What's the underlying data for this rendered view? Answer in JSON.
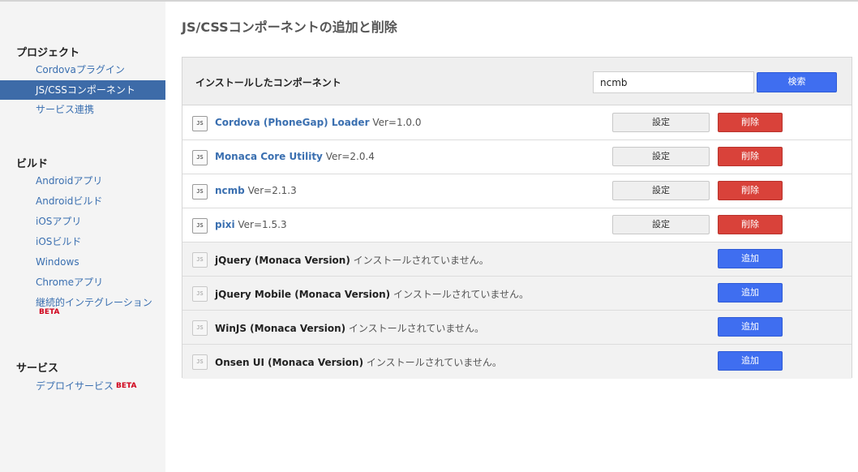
{
  "sidebar": {
    "sections": [
      {
        "title": "プロジェクト",
        "items": [
          {
            "label": "Cordovaプラグイン",
            "active": false
          },
          {
            "label": "JS/CSSコンポーネント",
            "active": true
          },
          {
            "label": "サービス連携",
            "active": false
          }
        ]
      },
      {
        "title": "ビルド",
        "items": [
          {
            "label": "Androidアプリ"
          },
          {
            "label": "Androidビルド"
          },
          {
            "label": "iOSアプリ"
          },
          {
            "label": "iOSビルド"
          },
          {
            "label": "Windows"
          },
          {
            "label": "Chromeアプリ"
          },
          {
            "label": "継続的インテグレーション",
            "badge": "BETA"
          }
        ]
      },
      {
        "title": "サービス",
        "items": [
          {
            "label": "デプロイサービス",
            "badge": "BETA"
          }
        ]
      }
    ]
  },
  "main": {
    "title": "JS/CSSコンポーネントの追加と削除",
    "panel_heading": "インストールしたコンポーネント",
    "search": {
      "value": "ncmb",
      "button_label": "検索"
    },
    "icon_text": "JS",
    "installed": [
      {
        "name": "Cordova (PhoneGap) Loader",
        "version": "Ver=1.0.0"
      },
      {
        "name": "Monaca Core Utility",
        "version": "Ver=2.0.4"
      },
      {
        "name": "ncmb",
        "version": "Ver=2.1.3"
      },
      {
        "name": "pixi",
        "version": "Ver=1.5.3"
      }
    ],
    "available": [
      {
        "name": "jQuery (Monaca Version)",
        "status": "インストールされていません。"
      },
      {
        "name": "jQuery Mobile (Monaca Version)",
        "status": "インストールされていません。"
      },
      {
        "name": "WinJS (Monaca Version)",
        "status": "インストールされていません。"
      },
      {
        "name": "Onsen UI (Monaca Version)",
        "status": "インストールされていません。"
      }
    ],
    "settings_label": "設定",
    "delete_label": "削除",
    "add_label": "追加"
  },
  "colors": {
    "accent_blue": "#3f6ef0",
    "delete_red": "#d9423a",
    "active_nav": "#3d6ba8",
    "link_blue": "#3a6fb0"
  }
}
